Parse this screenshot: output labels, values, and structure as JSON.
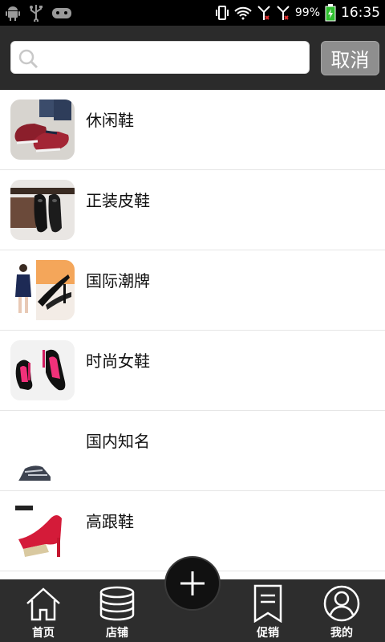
{
  "status_bar": {
    "battery": "99%",
    "time": "16:35",
    "icons": [
      "android-icon",
      "usb-icon",
      "game-controller-icon",
      "vibrate-icon",
      "wifi-icon",
      "signal-1-icon",
      "signal-2-icon",
      "battery-charging-icon"
    ]
  },
  "search": {
    "placeholder": "",
    "value": "",
    "cancel_label": "取消"
  },
  "categories": [
    {
      "label": "休闲鞋",
      "thumb": "casual-shoes-image"
    },
    {
      "label": "正装皮鞋",
      "thumb": "formal-leather-shoes-image"
    },
    {
      "label": "国际潮牌",
      "thumb": "international-trend-brand-image"
    },
    {
      "label": "时尚女鞋",
      "thumb": "fashion-women-shoes-image"
    },
    {
      "label": "国内知名",
      "thumb": "domestic-brand-image"
    },
    {
      "label": "高跟鞋",
      "thumb": "high-heels-image"
    }
  ],
  "bottom_nav": {
    "items": [
      {
        "label": "首页",
        "icon": "home-icon"
      },
      {
        "label": "店铺",
        "icon": "database-icon"
      },
      {
        "label": "促销",
        "icon": "bookmark-icon"
      },
      {
        "label": "我的",
        "icon": "user-icon"
      }
    ],
    "fab_icon": "plus-icon"
  },
  "colors": {
    "header_bg": "#2b2b2b",
    "nav_bg": "#2d2d2d",
    "cancel_bg": "#8e8e8e"
  }
}
